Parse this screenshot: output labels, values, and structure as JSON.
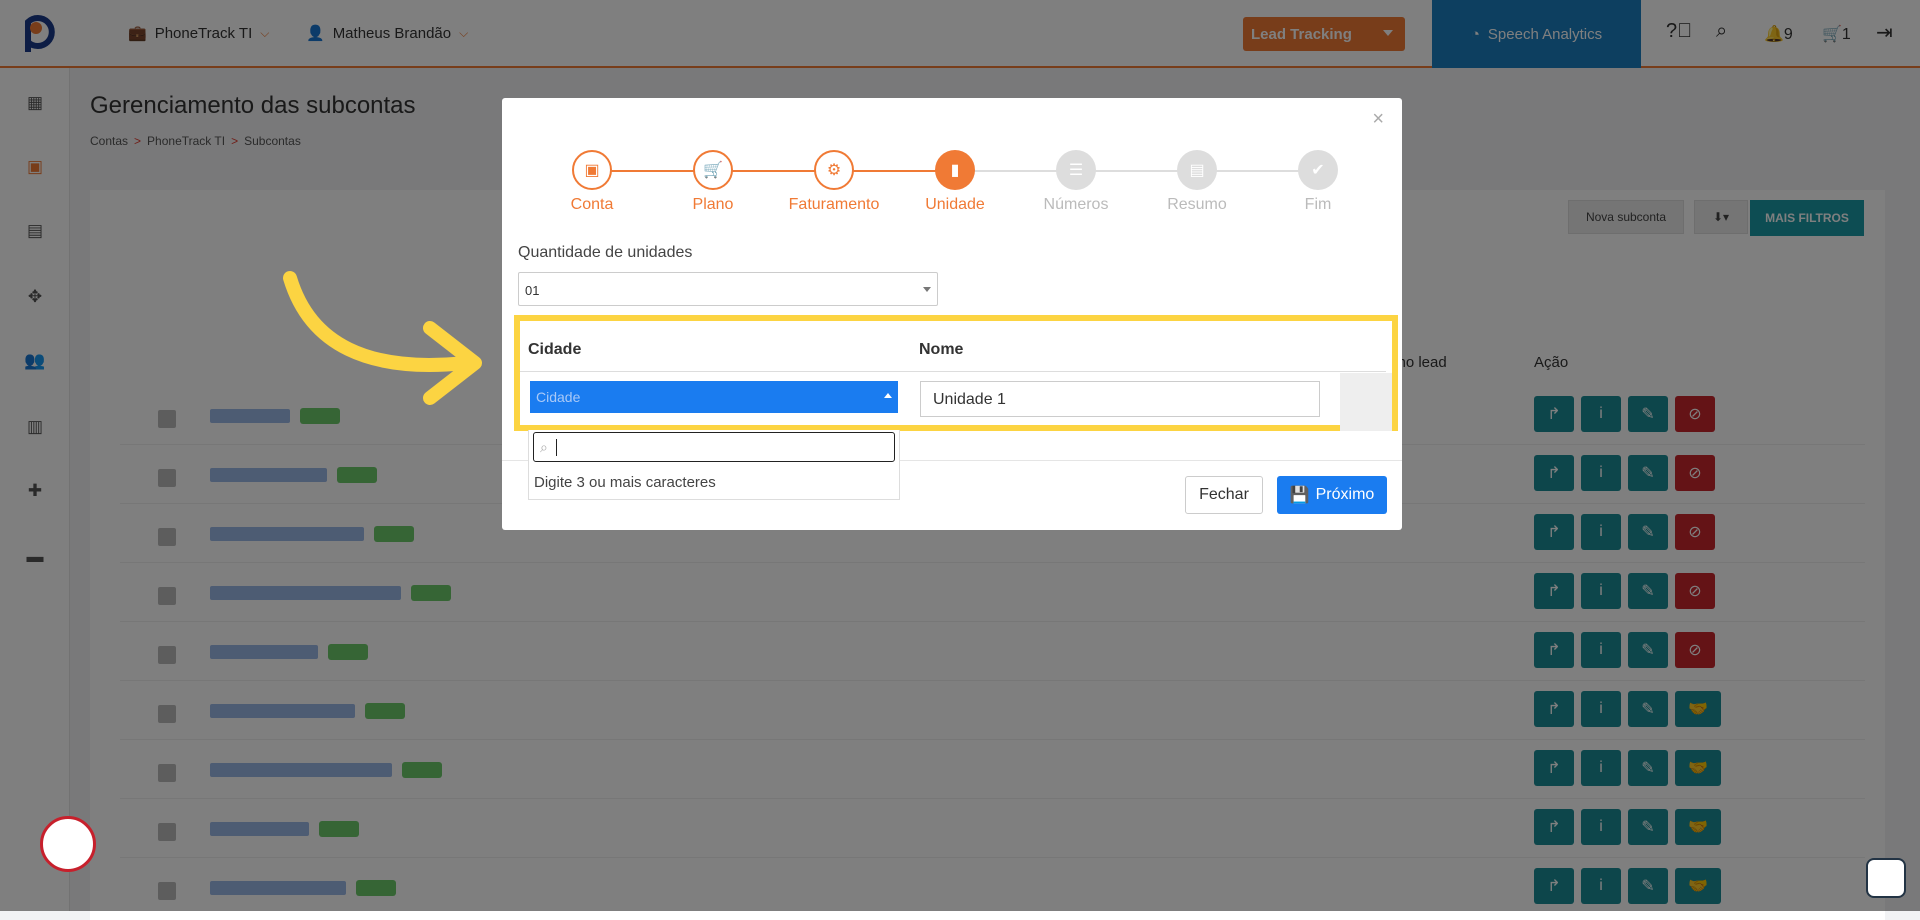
{
  "topbar": {
    "company": "PhoneTrack TI",
    "user": "Matheus Brandão",
    "lead_tracking": "Lead Tracking",
    "speech_analytics": "Speech Analytics",
    "notifications_count": "9",
    "cart_count": "1"
  },
  "page": {
    "title": "Gerenciamento das subcontas",
    "breadcrumb": [
      "Contas",
      "PhoneTrack TI",
      "Subcontas"
    ],
    "nova_subconta": "Nova subconta",
    "mais_filtros": "MAIS FILTROS",
    "col_ultimo_lead": "imo lead",
    "col_acao": "Ação"
  },
  "modal": {
    "steps": [
      {
        "label": "Conta",
        "icon": "briefcase-icon",
        "state": "done"
      },
      {
        "label": "Plano",
        "icon": "cart-icon",
        "state": "done"
      },
      {
        "label": "Faturamento",
        "icon": "gears-icon",
        "state": "done"
      },
      {
        "label": "Unidade",
        "icon": "building-icon",
        "state": "current"
      },
      {
        "label": "Números",
        "icon": "list-icon",
        "state": "todo"
      },
      {
        "label": "Resumo",
        "icon": "document-icon",
        "state": "todo"
      },
      {
        "label": "Fim",
        "icon": "check-icon",
        "state": "todo"
      }
    ],
    "qty_label": "Quantidade de unidades",
    "qty_value": "01",
    "table": {
      "col_cidade": "Cidade",
      "col_nome": "Nome",
      "cidade_placeholder": "Cidade",
      "nome_value": "Unidade 1"
    },
    "dropdown_hint": "Digite 3 ou mais caracteres",
    "fechar": "Fechar",
    "proximo": "Próximo"
  },
  "colors": {
    "orange": "#f07a35",
    "blue": "#1a7cf0",
    "teal": "#1b8d96",
    "red": "#c8262d",
    "highlight": "#fcd442"
  }
}
